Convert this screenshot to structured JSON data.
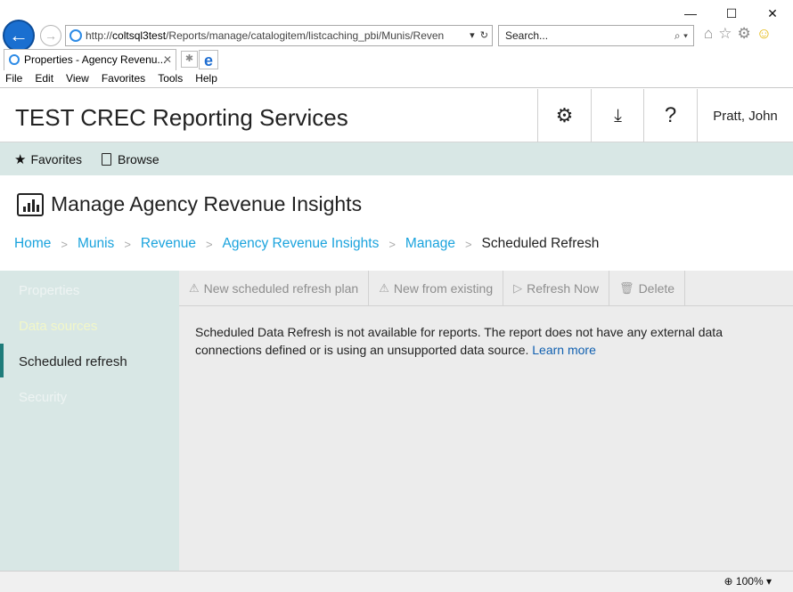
{
  "browser": {
    "window_controls": {
      "minimize": "—",
      "maximize": "☐",
      "close": "✕"
    },
    "address": {
      "prefix": "http://",
      "host": "coltsql3test",
      "path": "/Reports/manage/catalogitem/listcaching_pbi/Munis/Reven"
    },
    "search_placeholder": "Search...",
    "tab_title": "Properties - Agency Revenu...",
    "menu": [
      "File",
      "Edit",
      "View",
      "Favorites",
      "Tools",
      "Help"
    ],
    "zoom": "100%"
  },
  "header": {
    "title": "TEST CREC Reporting Services",
    "user": "Pratt, John"
  },
  "nav": {
    "favorites": "Favorites",
    "browse": "Browse"
  },
  "page": {
    "title": "Manage Agency Revenue Insights",
    "breadcrumb": [
      "Home",
      "Munis",
      "Revenue",
      "Agency Revenue Insights",
      "Manage"
    ],
    "breadcrumb_current": "Scheduled Refresh"
  },
  "sidebar": {
    "items": [
      "Properties",
      "Data sources",
      "Scheduled refresh",
      "Security"
    ],
    "active": "Scheduled refresh"
  },
  "commands": {
    "new_plan": "New scheduled refresh plan",
    "new_existing": "New from existing",
    "refresh_now": "Refresh Now",
    "delete": "Delete"
  },
  "message": {
    "text": "Scheduled Data Refresh is not available for reports. The report does not have any external data connections defined or is using an unsupported data source.",
    "link": "Learn more"
  },
  "colors": {
    "nav_bg": "#d8e7e5",
    "link": "#1aa3dd",
    "active_bar": "#1e7c7a"
  }
}
